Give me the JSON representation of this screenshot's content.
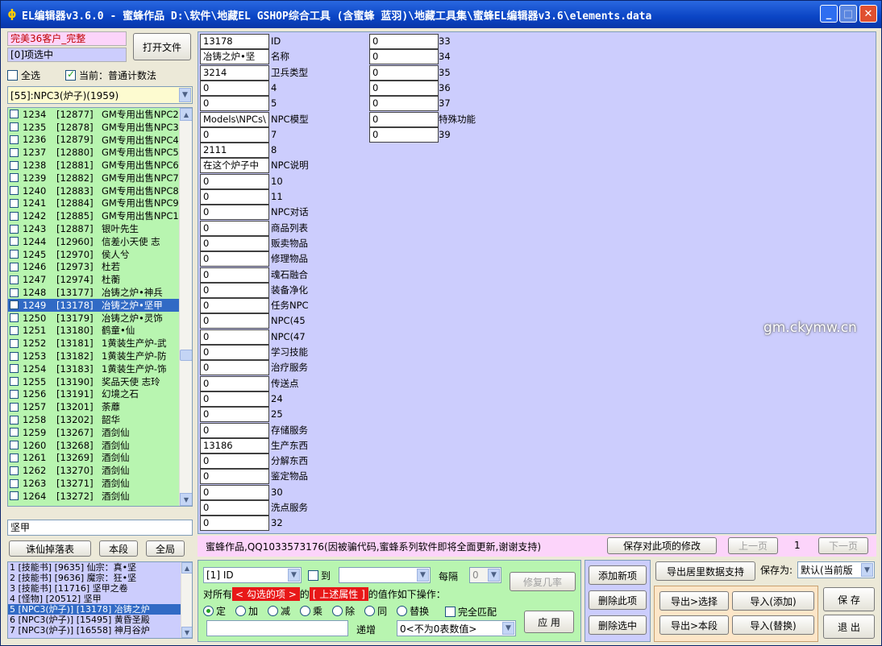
{
  "window": {
    "title": "EL编辑器v3.6.0  -  蜜蜂作品  D:\\软件\\地藏EL GSHOP综合工具 (含蜜蜂 蓝羽)\\地藏工具集\\蜜蜂EL编辑器v3.6\\elements.data",
    "min": "_",
    "max": "□",
    "close": "✕"
  },
  "left": {
    "client_label": "完美36客户_完整",
    "selected_count": "[0]项选中",
    "open_file": "打开文件",
    "select_all": "全选",
    "current_mode": "当前：普通计数法",
    "type_combo": "[55]:NPC3(炉子)(1959)",
    "items": [
      {
        "no": "1234",
        "id": "[12877]",
        "name": "GM专用出售NPC2"
      },
      {
        "no": "1235",
        "id": "[12878]",
        "name": "GM专用出售NPC3"
      },
      {
        "no": "1236",
        "id": "[12879]",
        "name": "GM专用出售NPC4"
      },
      {
        "no": "1237",
        "id": "[12880]",
        "name": "GM专用出售NPC5"
      },
      {
        "no": "1238",
        "id": "[12881]",
        "name": "GM专用出售NPC6"
      },
      {
        "no": "1239",
        "id": "[12882]",
        "name": "GM专用出售NPC7"
      },
      {
        "no": "1240",
        "id": "[12883]",
        "name": "GM专用出售NPC8"
      },
      {
        "no": "1241",
        "id": "[12884]",
        "name": "GM专用出售NPC9"
      },
      {
        "no": "1242",
        "id": "[12885]",
        "name": "GM专用出售NPC1"
      },
      {
        "no": "1243",
        "id": "[12887]",
        "name": "银叶先生"
      },
      {
        "no": "1244",
        "id": "[12960]",
        "name": "信差小天使  志"
      },
      {
        "no": "1245",
        "id": "[12970]",
        "name": "侯人兮"
      },
      {
        "no": "1246",
        "id": "[12973]",
        "name": "杜若"
      },
      {
        "no": "1247",
        "id": "[12974]",
        "name": "杜蘅"
      },
      {
        "no": "1248",
        "id": "[13177]",
        "name": "冶铸之炉•神兵"
      },
      {
        "no": "1249",
        "id": "[13178]",
        "name": "冶铸之炉•坚甲"
      },
      {
        "no": "1250",
        "id": "[13179]",
        "name": "冶铸之炉•灵饰"
      },
      {
        "no": "1251",
        "id": "[13180]",
        "name": "鹤童•仙"
      },
      {
        "no": "1252",
        "id": "[13181]",
        "name": "1黄装生产炉-武"
      },
      {
        "no": "1253",
        "id": "[13182]",
        "name": "1黄装生产炉-防"
      },
      {
        "no": "1254",
        "id": "[13183]",
        "name": "1黄装生产炉-饰"
      },
      {
        "no": "1255",
        "id": "[13190]",
        "name": "奖品天使  志玲"
      },
      {
        "no": "1256",
        "id": "[13191]",
        "name": "幻境之石"
      },
      {
        "no": "1257",
        "id": "[13201]",
        "name": "荼蘼"
      },
      {
        "no": "1258",
        "id": "[13202]",
        "name": "韶华"
      },
      {
        "no": "1259",
        "id": "[13267]",
        "name": "酒剑仙"
      },
      {
        "no": "1260",
        "id": "[13268]",
        "name": "酒剑仙"
      },
      {
        "no": "1261",
        "id": "[13269]",
        "name": "酒剑仙"
      },
      {
        "no": "1262",
        "id": "[13270]",
        "name": "酒剑仙"
      },
      {
        "no": "1263",
        "id": "[13271]",
        "name": "酒剑仙"
      },
      {
        "no": "1264",
        "id": "[13272]",
        "name": "酒剑仙"
      }
    ],
    "selected_index": 15,
    "search_text": "坚甲",
    "btn_drop": "诛仙掉落表",
    "btn_section": "本段",
    "btn_all": "全局",
    "results": [
      "1 [技能书] [9635] 仙宗：真•坚",
      "2 [技能书] [9636] 魔宗：狂•坚",
      "3 [技能书] [11716] 坚甲之卷",
      "4 [怪物] [20512] 坚甲",
      "5 [NPC3(炉子)] [13178] 冶铸之炉",
      "6 [NPC3(炉子)] [15495] 黄昏圣殿",
      "7 [NPC3(炉子)] [16558] 神月谷炉"
    ],
    "results_selected": 4
  },
  "fields_col1": [
    {
      "value": "13178",
      "label": "ID"
    },
    {
      "value": "冶铸之炉•坚",
      "label": "名称"
    },
    {
      "value": "3214",
      "label": "卫兵类型"
    },
    {
      "value": "0",
      "label": "4"
    },
    {
      "value": "0",
      "label": "5"
    },
    {
      "value": "Models\\NPCs\\",
      "label": "NPC模型"
    },
    {
      "value": "0",
      "label": "7"
    },
    {
      "value": "2111",
      "label": "8"
    },
    {
      "value": "在这个炉子中",
      "label": "NPC说明"
    },
    {
      "value": "0",
      "label": "10"
    },
    {
      "value": "0",
      "label": "11"
    },
    {
      "value": "0",
      "label": "NPC对话"
    },
    {
      "value": "0",
      "label": "商品列表"
    },
    {
      "value": "0",
      "label": "贩卖物品"
    },
    {
      "value": "0",
      "label": "修理物品"
    },
    {
      "value": "0",
      "label": "魂石融合"
    },
    {
      "value": "0",
      "label": "装备净化"
    },
    {
      "value": "0",
      "label": "任务NPC"
    },
    {
      "value": "0",
      "label": "NPC(45"
    },
    {
      "value": "0",
      "label": "NPC(47"
    },
    {
      "value": "0",
      "label": "学习技能"
    },
    {
      "value": "0",
      "label": "治疗服务"
    },
    {
      "value": "0",
      "label": "传送点"
    },
    {
      "value": "0",
      "label": "24"
    },
    {
      "value": "0",
      "label": "25"
    },
    {
      "value": "0",
      "label": "存储服务"
    },
    {
      "value": "13186",
      "label": "生产东西"
    },
    {
      "value": "0",
      "label": "分解东西"
    },
    {
      "value": "0",
      "label": "鉴定物品"
    },
    {
      "value": "0",
      "label": "30"
    },
    {
      "value": "0",
      "label": "洗点服务"
    },
    {
      "value": "0",
      "label": "32"
    }
  ],
  "fields_col2": [
    {
      "value": "0",
      "label": "33"
    },
    {
      "value": "0",
      "label": "34"
    },
    {
      "value": "0",
      "label": "35"
    },
    {
      "value": "0",
      "label": "36"
    },
    {
      "value": "0",
      "label": "37"
    },
    {
      "value": "0",
      "label": "特殊功能"
    },
    {
      "value": "0",
      "label": "39"
    }
  ],
  "status": {
    "text": "蜜蜂作品,QQ1033573176(因被骗代码,蜜蜂系列软件即将全面更新,谢谢支持)",
    "save_btn": "保存对此项的修改",
    "prev": "上一页",
    "page": "1",
    "next": "下一页"
  },
  "batch": {
    "field_combo": "[1] ID",
    "to_label": "到",
    "to_combo": "",
    "every_label": "每隔",
    "every_combo": "0",
    "repair_btn": "修复几率",
    "prefix": "对所有",
    "target_sel": "< 勾选的项 >",
    "of": "的",
    "attr_sel": "[ 上述属性 ]",
    "suffix": "的值作如下操作：",
    "ops": [
      "定",
      "加",
      "减",
      "乘",
      "除",
      "同",
      "替换"
    ],
    "op_selected": 0,
    "exact_match": "完全匹配",
    "value_input": "",
    "incr_label": "递增",
    "incr_combo": "0<不为0表数值>",
    "apply_btn": "应 用"
  },
  "actions": {
    "add_item": "添加新项",
    "delete_item": "删除此项",
    "delete_selected": "删除选中",
    "export_support": "导出居里数据支持",
    "save_as_label": "保存为:",
    "save_as_combo": "默认(当前版",
    "export_selected": "导出>选择",
    "import_add": "导入(添加)",
    "export_section": "导出>本段",
    "import_replace": "导入(替换)",
    "save": "保 存",
    "exit": "退 出"
  },
  "watermark": "gm.ckymw.cn"
}
